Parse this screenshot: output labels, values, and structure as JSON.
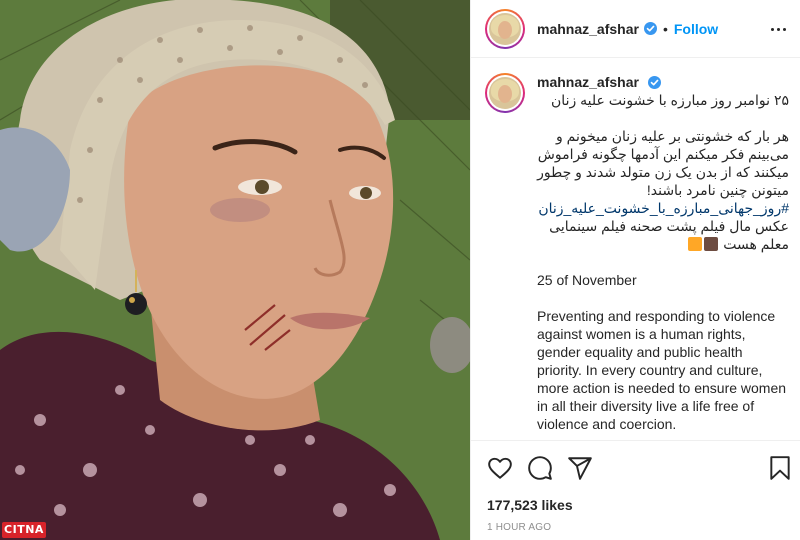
{
  "post": {
    "username": "mahnaz_afshar",
    "follow_label": "Follow",
    "dot": "•",
    "caption": {
      "line1": "۲۵ نوامبر روز مبارزه با خشونت علیه زنان",
      "para1": "هر بار که خشونتی بر علیه زنان میخونم و می‌بینم فکر میکنم این آدمها چگونه فراموش میکنند که از بدن یک زن متولد شدند و چطور میتونن چنین نامرد باشند!",
      "hashtag": "#روز_جهانی_مبارزه_با_خشونت_علیه_زنان",
      "para2": "عکس مال فیلم پشت صحنه فیلم سینمایی",
      "para3": "معلم هست",
      "english_date": "25 of November",
      "english_body": "Preventing and responding to violence against women is a human rights, gender equality and public health priority. In every country and culture, more action is needed to ensure women in all their diversity live a life free of violence and coercion."
    },
    "likes": "177,523 likes",
    "time": "1 HOUR AGO"
  },
  "watermark": "CITNA",
  "icons": {
    "like": "heart-icon",
    "comment": "comment-icon",
    "share": "paper-plane-icon",
    "save": "bookmark-icon",
    "verified": "verified-badge-icon",
    "more": "more-options-icon"
  },
  "colors": {
    "accent": "#0095f6",
    "verified": "#3897f0",
    "hashtag": "#00376b",
    "muted": "#8e8e8e",
    "watermark_bg": "#d8232a"
  }
}
